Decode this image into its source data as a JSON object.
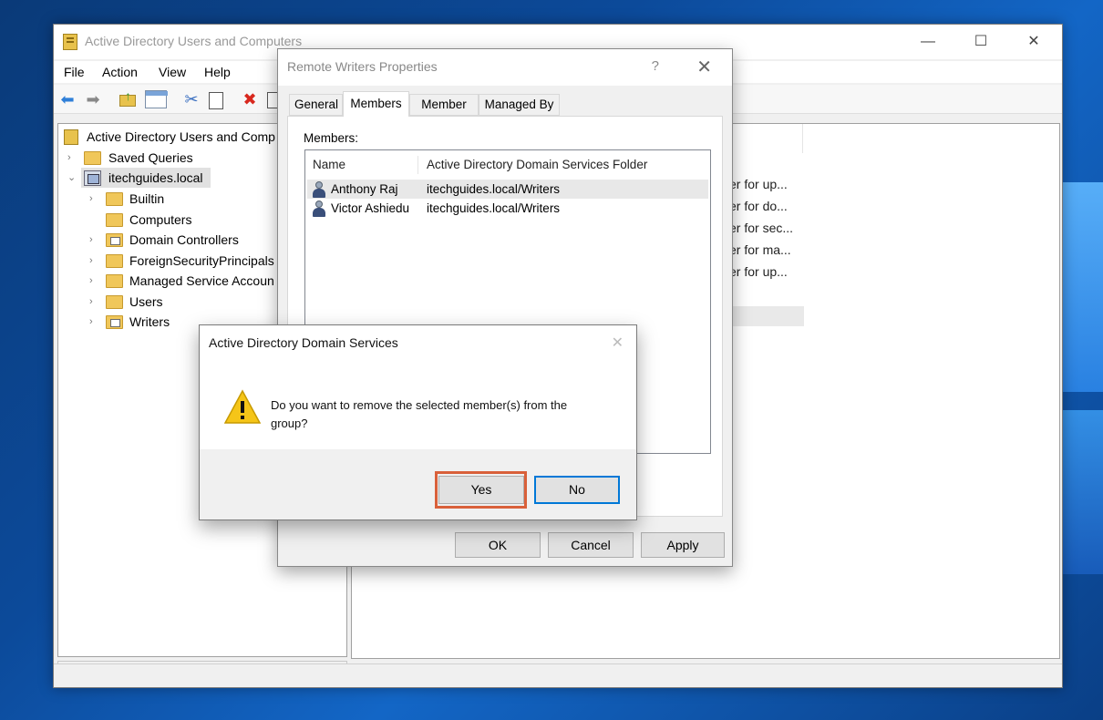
{
  "main_window": {
    "title": "Active Directory Users and Computers",
    "controls": {
      "minimize": "—",
      "maximize": "☐",
      "close": "✕"
    },
    "menu": [
      "File",
      "Action",
      "View",
      "Help"
    ],
    "toolbar_icons": [
      "back-arrow-icon",
      "forward-arrow-icon",
      "up-folder-icon",
      "show-console-tree-icon",
      "cut-icon",
      "paste-icon",
      "delete-icon",
      "properties-icon"
    ]
  },
  "tree": {
    "root": "Active Directory Users and Comp",
    "items": [
      {
        "label": "Saved Queries"
      },
      {
        "label": "itechguides.local"
      },
      {
        "label": "Builtin"
      },
      {
        "label": "Computers"
      },
      {
        "label": "Domain Controllers"
      },
      {
        "label": "ForeignSecurityPrincipals"
      },
      {
        "label": "Managed Service Accoun"
      },
      {
        "label": "Users"
      },
      {
        "label": "Writers"
      }
    ]
  },
  "right_pane": {
    "descriptions": [
      "er for up...",
      "er for do...",
      "er for sec...",
      "er for ma...",
      "er for up..."
    ]
  },
  "properties_dialog": {
    "title": "Remote Writers Properties",
    "help": "?",
    "close": "✕",
    "tabs": [
      "General",
      "Members",
      "Member Of",
      "Managed By"
    ],
    "active_tab": "Members",
    "members_label": "Members:",
    "columns": [
      "Name",
      "Active Directory Domain Services Folder"
    ],
    "members": [
      {
        "name": "Anthony Raj",
        "folder": "itechguides.local/Writers"
      },
      {
        "name": "Victor Ashiedu",
        "folder": "itechguides.local/Writers"
      }
    ],
    "buttons": {
      "ok": "OK",
      "cancel": "Cancel",
      "apply": "Apply"
    }
  },
  "confirm_dialog": {
    "title": "Active Directory Domain Services",
    "close": "✕",
    "message": "Do you want to remove the selected member(s) from the group?",
    "yes": "Yes",
    "no": "No",
    "highlight_color": "#d9603a"
  },
  "colors": {
    "accent": "#0078d7",
    "warning": "#f5c518",
    "delete": "#d8281e"
  }
}
